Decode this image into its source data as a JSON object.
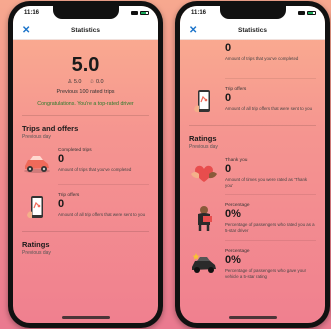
{
  "status_bar": {
    "time": "11:16"
  },
  "header": {
    "title": "Statistics",
    "close_glyph": "✕"
  },
  "summary": {
    "rating": "5.0",
    "five_star_count": "5.0",
    "low_star_count": "0.0",
    "description": "Previous 100 rated trips",
    "congrats": "Congratulations. You're a top-rated driver"
  },
  "trips_section": {
    "title": "Trips and offers",
    "subtitle": "Previous day",
    "items": [
      {
        "label": "Completed trips",
        "value": "0",
        "desc": "Amount of trips that you've completed",
        "icon": "car-icon"
      },
      {
        "label": "Trip offers",
        "value": "0",
        "desc": "Amount of all trip offers that were sent to you",
        "icon": "phone-icon"
      }
    ]
  },
  "ratings_section": {
    "title": "Ratings",
    "subtitle": "Previous day",
    "items": [
      {
        "label": "Thank you",
        "value": "0",
        "desc": "Amount of times you were rated as 'Thank you'",
        "icon": "heart-hands-icon"
      },
      {
        "label": "Percentage",
        "value": "0%",
        "desc": "Percentage of passengers who rated you as a 5-star driver",
        "icon": "passenger-icon"
      },
      {
        "label": "Percentage",
        "value": "0%",
        "desc": "Percentage of passengers who gave your vehicle a 5-star rating",
        "icon": "vehicle-star-icon"
      }
    ]
  },
  "right_top": {
    "value": "0",
    "desc": "Amount of trips that you've completed"
  },
  "colors": {
    "accent": "#1a73c9",
    "success": "#2a7a2a",
    "bg_top": "#fbb090",
    "bg_bottom": "#f0808f"
  }
}
